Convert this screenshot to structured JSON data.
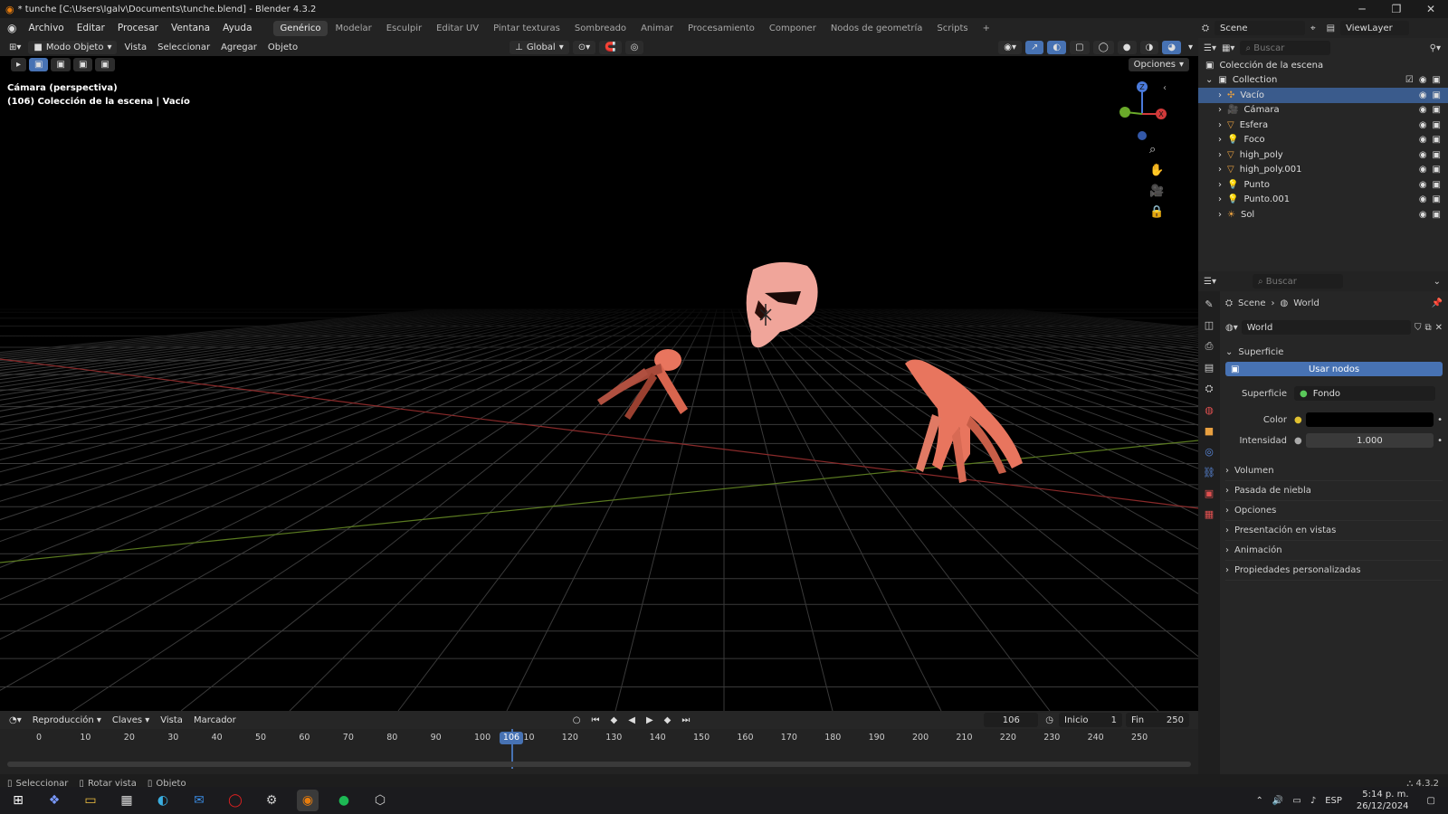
{
  "window": {
    "title": "* tunche [C:\\Users\\Igalv\\Documents\\tunche.blend] - Blender 4.3.2",
    "minimize": "─",
    "maximize": "❐",
    "close": "✕"
  },
  "menu": {
    "items": [
      "Archivo",
      "Editar",
      "Procesar",
      "Ventana",
      "Ayuda"
    ]
  },
  "workspaces": {
    "tabs": [
      "Genérico",
      "Modelar",
      "Esculpir",
      "Editar UV",
      "Pintar texturas",
      "Sombreado",
      "Animar",
      "Procesamiento",
      "Componer",
      "Nodos de geometría",
      "Scripts"
    ],
    "active": "Genérico",
    "add": "+"
  },
  "scene_selector": {
    "scene": "Scene",
    "view_layer": "ViewLayer"
  },
  "viewport_header": {
    "mode": "Modo Objeto",
    "menus": [
      "Vista",
      "Seleccionar",
      "Agregar",
      "Objeto"
    ],
    "transform": "Global",
    "options": "Opciones"
  },
  "viewport_info": {
    "line1": "Cámara (perspectiva)",
    "line2": "(106) Colección de la escena | Vacío"
  },
  "gizmo": {
    "z": "Z",
    "x": "X"
  },
  "timeline": {
    "menus": [
      "Reproducción",
      "Claves",
      "Vista",
      "Marcador"
    ],
    "current_frame": "106",
    "start_label": "Inicio",
    "start": "1",
    "end_label": "Fin",
    "end": "250",
    "ticks": [
      "0",
      "10",
      "20",
      "30",
      "40",
      "50",
      "60",
      "70",
      "80",
      "90",
      "100",
      "110",
      "120",
      "130",
      "140",
      "150",
      "160",
      "170",
      "180",
      "190",
      "200",
      "210",
      "220",
      "230",
      "240",
      "250"
    ]
  },
  "status": {
    "items": [
      "Seleccionar",
      "Rotar vista",
      "Objeto"
    ],
    "version": "4.3.2"
  },
  "outliner": {
    "search_placeholder": "Buscar",
    "root": "Colección de la escena",
    "collection": "Collection",
    "items": [
      {
        "name": "Vacío",
        "selected": true
      },
      {
        "name": "Cámara",
        "selected": false
      },
      {
        "name": "Esfera",
        "selected": false
      },
      {
        "name": "Foco",
        "selected": false
      },
      {
        "name": "high_poly",
        "selected": false
      },
      {
        "name": "high_poly.001",
        "selected": false
      },
      {
        "name": "Punto",
        "selected": false
      },
      {
        "name": "Punto.001",
        "selected": false
      },
      {
        "name": "Sol",
        "selected": false
      }
    ]
  },
  "properties": {
    "search_placeholder": "Buscar",
    "breadcrumb": [
      "Scene",
      "World"
    ],
    "world_name": "World",
    "section": "Superficie",
    "use_nodes": "Usar nodos",
    "surface_label": "Superficie",
    "surface_value": "Fondo",
    "color_label": "Color",
    "color_value": "#000000",
    "intensity_label": "Intensidad",
    "intensity_value": "1.000",
    "collapsed": [
      "Volumen",
      "Pasada de niebla",
      "Opciones",
      "Presentación en vistas",
      "Animación",
      "Propiedades personalizadas"
    ]
  },
  "taskbar": {
    "lang": "ESP",
    "time": "5:14 p. m.",
    "date": "26/12/2024"
  },
  "colors": {
    "accent": "#4772b3",
    "selection": "#3a5b8c",
    "mesh": "#e8755e"
  }
}
